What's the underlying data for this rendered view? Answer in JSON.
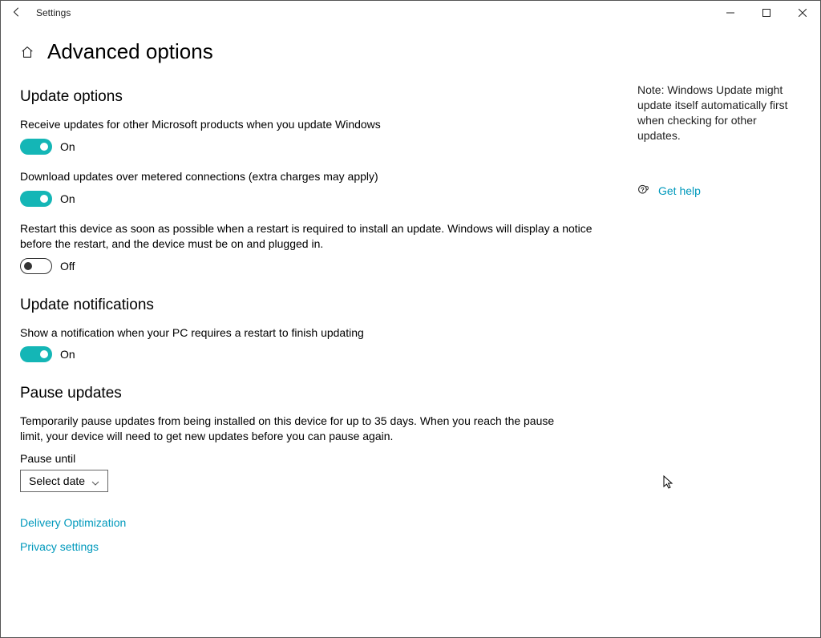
{
  "window": {
    "app_title": "Settings"
  },
  "page": {
    "title": "Advanced options"
  },
  "sections": {
    "update_options": {
      "heading": "Update options",
      "s1": {
        "desc": "Receive updates for other Microsoft products when you update Windows",
        "state": "On"
      },
      "s2": {
        "desc": "Download updates over metered connections (extra charges may apply)",
        "state": "On"
      },
      "s3": {
        "desc": "Restart this device as soon as possible when a restart is required to install an update. Windows will display a notice before the restart, and the device must be on and plugged in.",
        "state": "Off"
      }
    },
    "update_notifications": {
      "heading": "Update notifications",
      "s1": {
        "desc": "Show a notification when your PC requires a restart to finish updating",
        "state": "On"
      }
    },
    "pause_updates": {
      "heading": "Pause updates",
      "desc": "Temporarily pause updates from being installed on this device for up to 35 days. When you reach the pause limit, your device will need to get new updates before you can pause again.",
      "label": "Pause until",
      "dropdown": "Select date"
    }
  },
  "links": {
    "delivery": "Delivery Optimization",
    "privacy": "Privacy settings"
  },
  "side": {
    "note": "Note: Windows Update might update itself automatically first when checking for other updates.",
    "help": "Get help"
  }
}
